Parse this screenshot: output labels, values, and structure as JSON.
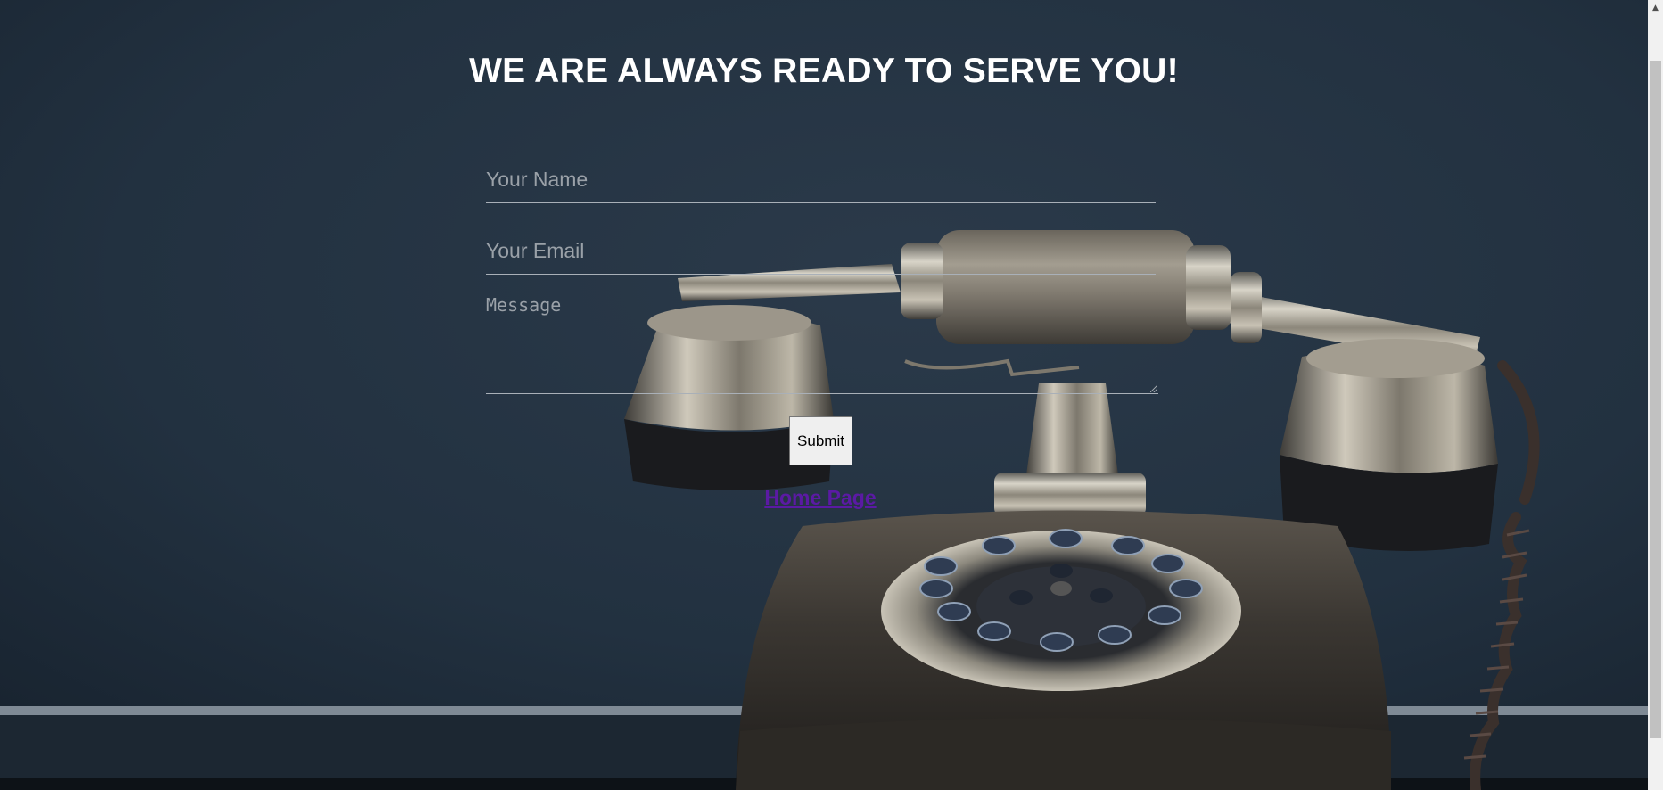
{
  "page": {
    "heading": "WE ARE ALWAYS READY TO SERVE YOU!"
  },
  "form": {
    "name_placeholder": "Your Name",
    "email_placeholder": "Your Email",
    "message_placeholder": "Message",
    "submit_label": "Submit"
  },
  "links": {
    "home_label": "Home Page"
  },
  "icons": {
    "scroll_up": "scroll-up-arrow-icon"
  },
  "colors": {
    "background": "#21303f",
    "heading": "#ffffff",
    "link_visited": "#5b1aa4"
  },
  "background_image": {
    "subject": "vintage-rotary-telephone"
  }
}
